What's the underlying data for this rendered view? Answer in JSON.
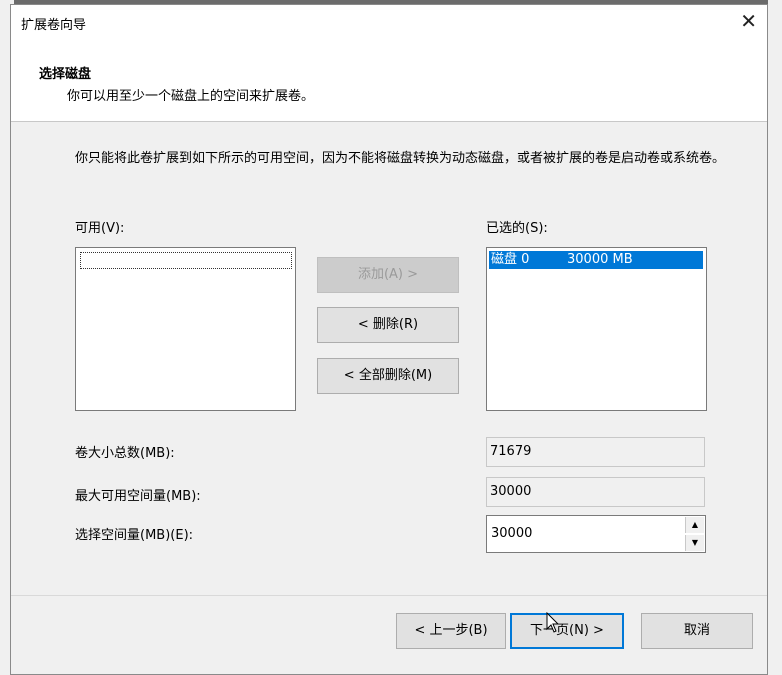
{
  "window": {
    "title": "扩展卷向导",
    "close_glyph": "✕"
  },
  "header": {
    "title": "选择磁盘",
    "subtitle": "你可以用至少一个磁盘上的空间来扩展卷。"
  },
  "description": "你只能将此卷扩展到如下所示的可用空间，因为不能将磁盘转换为动态磁盘，或者被扩展的卷是启动卷或系统卷。",
  "available": {
    "label": "可用(V):",
    "items": []
  },
  "selected": {
    "label": "已选的(S):",
    "items": [
      {
        "disk": "磁盘 0",
        "size": "30000 MB"
      }
    ]
  },
  "buttons": {
    "add": "添加(A) >",
    "remove": "< 删除(R)",
    "remove_all": "< 全部删除(M)"
  },
  "fields": {
    "total_label": "卷大小总数(MB):",
    "total_value": "71679",
    "max_label": "最大可用空间量(MB):",
    "max_value": "30000",
    "select_label": "选择空间量(MB)(E):",
    "select_value": "30000"
  },
  "footer": {
    "back": "< 上一步(B)",
    "next": "下一页(N) >",
    "cancel": "取消"
  },
  "colors": {
    "selection": "#0078d7",
    "dialog_bg": "#f0f0f0"
  }
}
